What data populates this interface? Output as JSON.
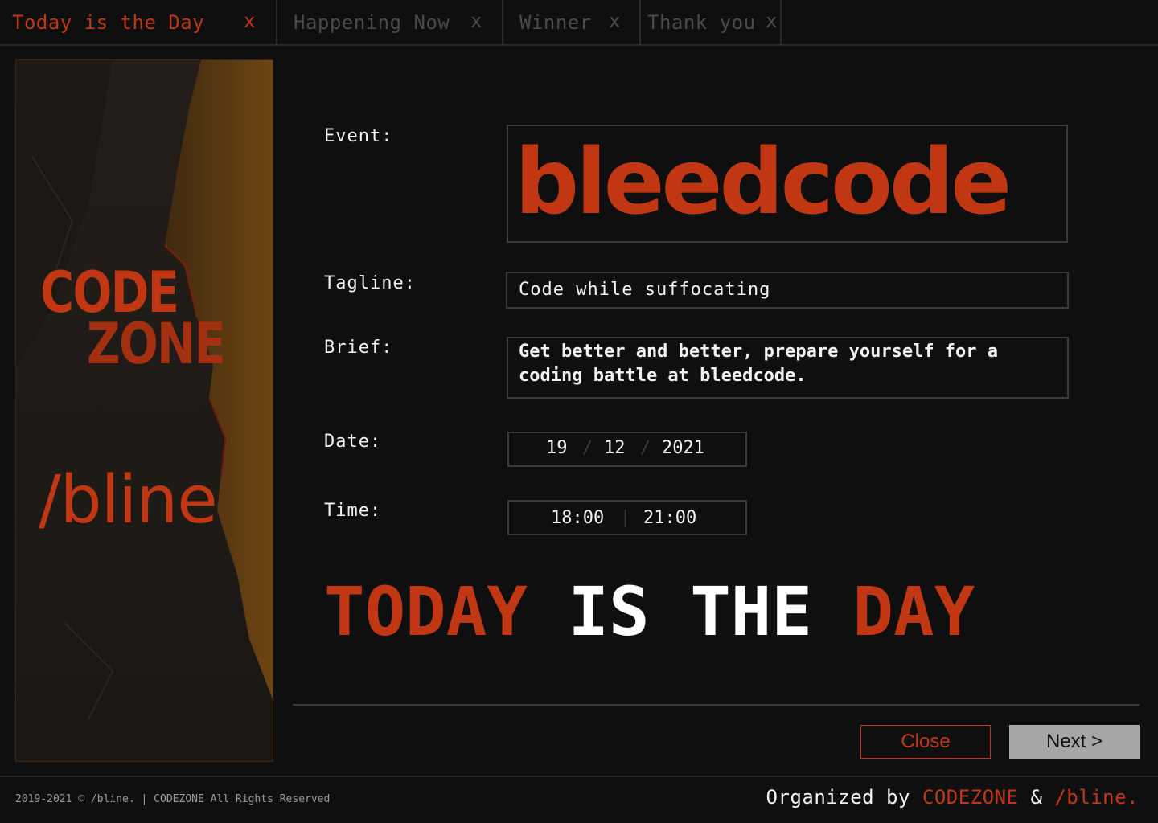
{
  "tabs": [
    {
      "label": "Today is the Day",
      "close": "x",
      "active": true
    },
    {
      "label": "Happening Now",
      "close": "x",
      "active": false
    },
    {
      "label": "Winner",
      "close": "x",
      "active": false
    },
    {
      "label": "Thank you",
      "close": "x",
      "active": false
    }
  ],
  "poster": {
    "line1": "CODE",
    "line2": "ZONE",
    "brand": "/bline"
  },
  "form": {
    "event_label": "Event:",
    "event_value": "bleedcode",
    "tagline_label": "Tagline:",
    "tagline_value": "Code while suffocating",
    "brief_label": "Brief:",
    "brief_value": "Get better and better, prepare yourself for a coding battle at bleedcode.",
    "date_label": "Date:",
    "date_day": "19",
    "date_month": "12",
    "date_year": "2021",
    "date_sep": "/",
    "time_label": "Time:",
    "time_start": "18:00",
    "time_end": "21:00",
    "time_sep": "|"
  },
  "headline": {
    "w1": "TODAY",
    "w2": "IS",
    "w3": "THE",
    "w4": "DAY"
  },
  "buttons": {
    "close": "Close",
    "next": "Next >"
  },
  "footer": {
    "copyright": "2019-2021 © /bline. | CODEZONE All Rights Reserved",
    "organized_prefix": "Organized by",
    "org1": "CODEZONE",
    "amp": "&",
    "org2": "/bline."
  },
  "colors": {
    "accent": "#c23713",
    "background": "#0f0f0f",
    "border": "#3a3a3a",
    "button_gray": "#a6a6a6"
  }
}
